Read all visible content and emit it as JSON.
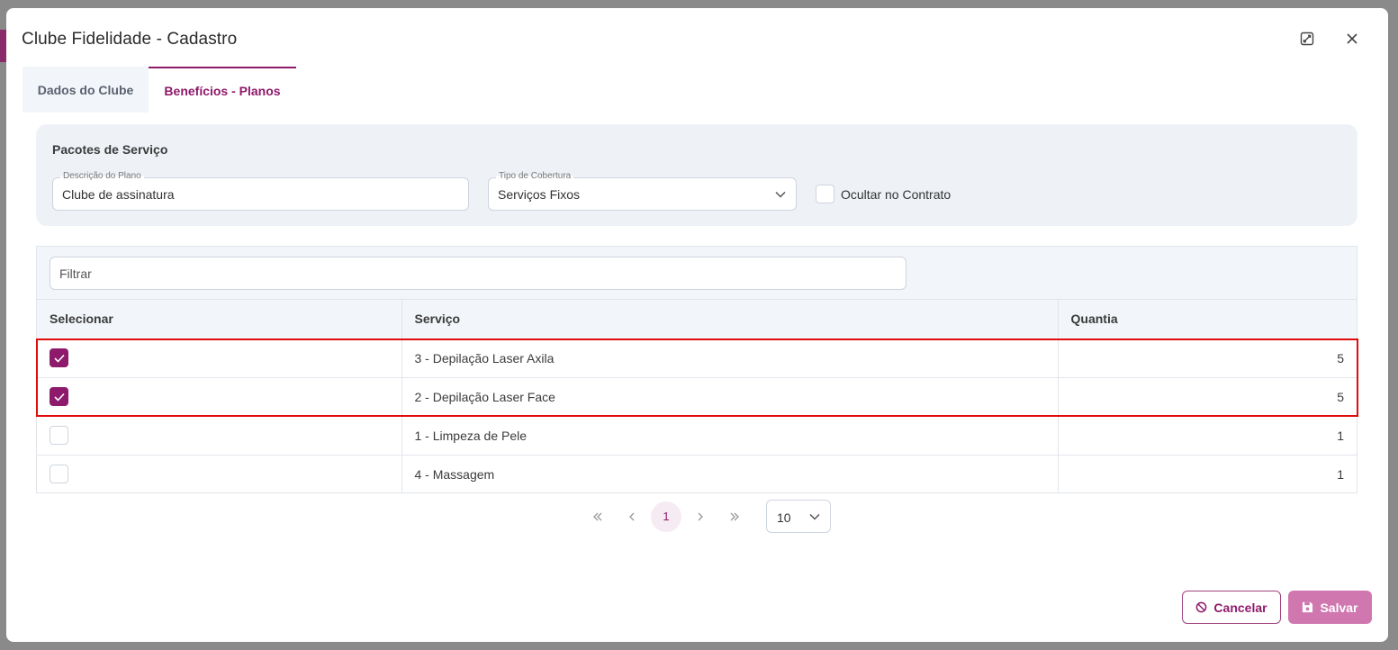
{
  "dialog": {
    "title": "Clube Fidelidade - Cadastro"
  },
  "tabs": [
    {
      "label": "Dados do Clube",
      "active": false
    },
    {
      "label": "Benefícios - Planos",
      "active": true
    }
  ],
  "package": {
    "title": "Pacotes de Serviço",
    "descricao": {
      "label": "Descrição do Plano",
      "value": "Clube de assinatura"
    },
    "tipo": {
      "label": "Tipo de Cobertura",
      "value": "Serviços Fixos"
    },
    "ocultar": {
      "label": "Ocultar no Contrato",
      "checked": false
    }
  },
  "table": {
    "filter_placeholder": "Filtrar",
    "columns": [
      "Selecionar",
      "Serviço",
      "Quantia"
    ],
    "rows": [
      {
        "selected": true,
        "servico": "3 - Depilação Laser Axila",
        "quantia": "5"
      },
      {
        "selected": true,
        "servico": "2 - Depilação Laser Face",
        "quantia": "5"
      },
      {
        "selected": false,
        "servico": "1 - Limpeza de Pele",
        "quantia": "1"
      },
      {
        "selected": false,
        "servico": "4 - Massagem",
        "quantia": "1"
      }
    ]
  },
  "pagination": {
    "current_page": "1",
    "rows_per_page": "10"
  },
  "actions": {
    "cancel_label": "Cancelar",
    "save_label": "Salvar"
  },
  "colors": {
    "accent": "#8e1a6b",
    "save_button": "#d077b0",
    "highlight": "#e00d0d"
  }
}
